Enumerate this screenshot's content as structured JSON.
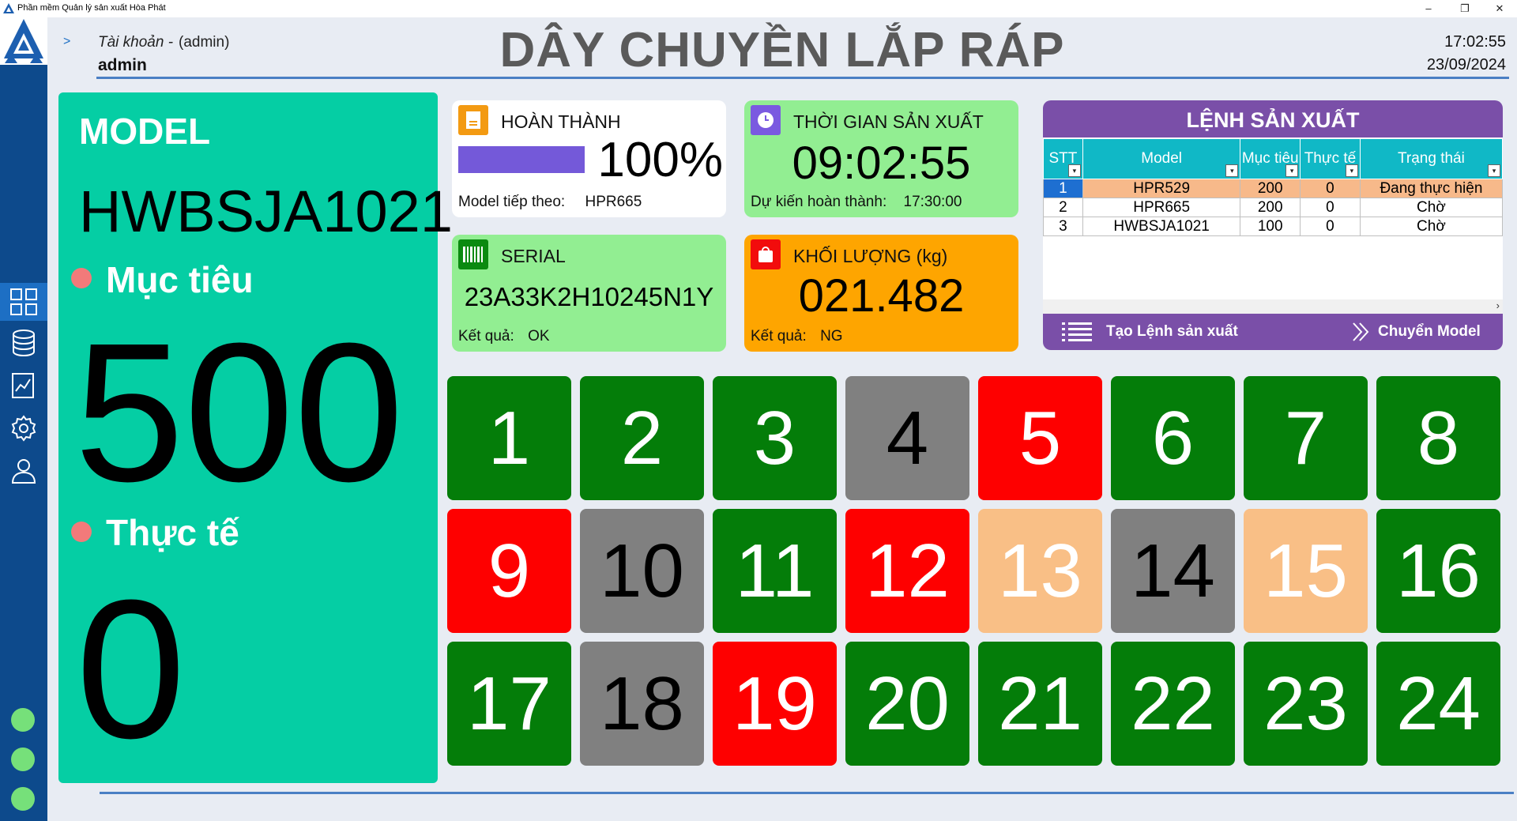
{
  "window": {
    "title": "Phần mềm Quản lý sản xuất Hòa Phát",
    "minimize": "–",
    "maximize": "❐",
    "close": "✕"
  },
  "sidebar": {
    "items": [
      {
        "icon": "grid-icon"
      },
      {
        "icon": "database-icon"
      },
      {
        "icon": "chart-icon"
      },
      {
        "icon": "gear-icon"
      },
      {
        "icon": "user-icon"
      }
    ]
  },
  "header": {
    "arrow": ">",
    "account_label": "Tài khoản -",
    "account_role": "(admin)",
    "account_user": "admin",
    "title": "DÂY CHUYỀN LẮP RÁP",
    "time": "17:02:55",
    "date": "23/09/2024"
  },
  "model_panel": {
    "model_label": "MODEL",
    "model_value": "HWBSJA1021",
    "target_label": "Mục tiêu",
    "target_value": "500",
    "actual_label": "Thực tế",
    "actual_value": "0"
  },
  "completion": {
    "title": "HOÀN THÀNH",
    "percent_text": "100%",
    "progress": 1.0,
    "next_label": "Model tiếp theo:",
    "next_value": "HPR665",
    "color": "#7459d9"
  },
  "production_time": {
    "title": "THỜI GIAN SẢN XUẤT",
    "value": "09:02:55",
    "expected_label": "Dự kiến hoàn thành:",
    "expected_value": "17:30:00"
  },
  "serial": {
    "title": "SERIAL",
    "value": "23A33K2H10245N1Y",
    "result_label": "Kết quả:",
    "result_value": "OK"
  },
  "weight": {
    "title": "KHỐI LƯỢNG (kg)",
    "value": "021.482",
    "result_label": "Kết quả:",
    "result_value": "NG"
  },
  "orders": {
    "title": "LỆNH SẢN XUẤT",
    "columns": [
      "STT",
      "Model",
      "Mục tiêu",
      "Thực tế",
      "Trạng thái"
    ],
    "rows": [
      {
        "stt": "1",
        "model": "HPR529",
        "target": "200",
        "actual": "0",
        "status": "Đang thực hiện"
      },
      {
        "stt": "2",
        "model": "HPR665",
        "target": "200",
        "actual": "0",
        "status": "Chờ"
      },
      {
        "stt": "3",
        "model": "HWBSJA1021",
        "target": "100",
        "actual": "0",
        "status": "Chờ"
      }
    ],
    "create_label": "Tạo Lệnh sản xuất",
    "switch_label": "Chuyển Model"
  },
  "colors": {
    "green": "#047d09",
    "gray": "#808080",
    "red": "#fe0000",
    "peach": "#f9bf86"
  },
  "stations": [
    {
      "number": "1",
      "status": "green"
    },
    {
      "number": "2",
      "status": "green"
    },
    {
      "number": "3",
      "status": "green"
    },
    {
      "number": "4",
      "status": "gray"
    },
    {
      "number": "5",
      "status": "red"
    },
    {
      "number": "6",
      "status": "green"
    },
    {
      "number": "7",
      "status": "green"
    },
    {
      "number": "8",
      "status": "green"
    },
    {
      "number": "9",
      "status": "red"
    },
    {
      "number": "10",
      "status": "gray"
    },
    {
      "number": "11",
      "status": "green"
    },
    {
      "number": "12",
      "status": "red"
    },
    {
      "number": "13",
      "status": "peach"
    },
    {
      "number": "14",
      "status": "gray"
    },
    {
      "number": "15",
      "status": "peach"
    },
    {
      "number": "16",
      "status": "green"
    },
    {
      "number": "17",
      "status": "green"
    },
    {
      "number": "18",
      "status": "gray"
    },
    {
      "number": "19",
      "status": "red"
    },
    {
      "number": "20",
      "status": "green"
    },
    {
      "number": "21",
      "status": "green"
    },
    {
      "number": "22",
      "status": "green"
    },
    {
      "number": "23",
      "status": "green"
    },
    {
      "number": "24",
      "status": "green"
    }
  ]
}
